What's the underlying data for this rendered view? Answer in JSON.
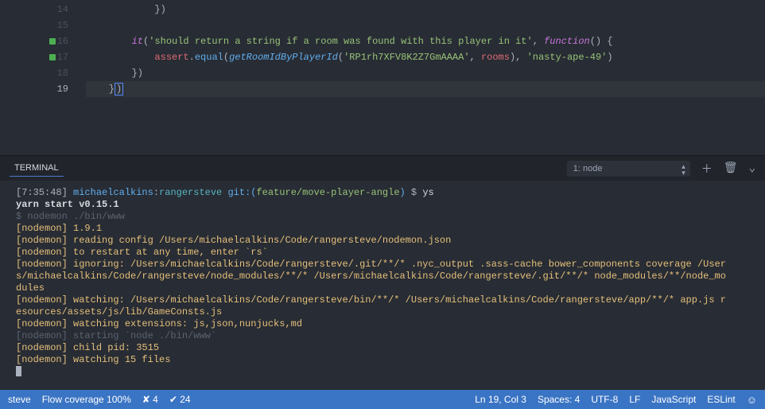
{
  "editor": {
    "lines": [
      14,
      15,
      16,
      17,
      18,
      19
    ],
    "code14_a": "            })",
    "code16_it": "        it",
    "code16_str": "'should return a string if a room was found with this player in it'",
    "code16_func": "function",
    "code16_rest": "() {",
    "code17_indent": "            ",
    "code17_assert": "assert",
    "code17_equal": "equal",
    "code17_fn": "getRoomIdByPlayerId",
    "code17_arg1": "'RP1rh7XFV8K2Z7GmAAAA'",
    "code17_rooms": "rooms",
    "code17_arg2": "'nasty-ape-49'",
    "code18_a": "        })",
    "code19_a": "    }",
    "code19_b": ")"
  },
  "panel": {
    "tab": "TERMINAL",
    "select": "1: node"
  },
  "term": {
    "time": "[7:35:48]",
    "user": "michaelcalkins",
    "host": "rangersteve",
    "gitpre": "git:(",
    "branch": "feature/move-player-angle",
    "gitpost": ")",
    "prompt": "$",
    "cmd": "ys",
    "l1": "yarn start v0.15.1",
    "l2": "$ nodemon ./bin/www",
    "l3a": "[nodemon]",
    "l3b": " 1.9.1",
    "l4a": "[nodemon]",
    "l4b": " reading config /Users/michaelcalkins/Code/rangersteve/nodemon.json",
    "l5a": "[nodemon]",
    "l5b": " to restart at any time, enter `rs`",
    "l6a": "[nodemon]",
    "l6b": " ignoring: /Users/michaelcalkins/Code/rangersteve/.git/**/* .nyc_output .sass-cache bower_components coverage /Users/michaelcalkins/Code/rangersteve/node_modules/**/* /Users/michaelcalkins/Code/rangersteve/.git/**/* node_modules/**/node_modules",
    "l7a": "[nodemon]",
    "l7b": " watching: /Users/michaelcalkins/Code/rangersteve/bin/**/* /Users/michaelcalkins/Code/rangersteve/app/**/* app.js resources/assets/js/lib/GameConsts.js",
    "l8a": "[nodemon]",
    "l8b": " watching extensions: js,json,nunjucks,md",
    "l9a": "[nodemon]",
    "l9b": " starting `node ./bin/www`",
    "l10a": "[nodemon]",
    "l10b": " child pid: 3515",
    "l11a": "[nodemon]",
    "l11b": " watching 15 files"
  },
  "status": {
    "steve": "steve",
    "flow": "Flow coverage 100%",
    "err": "✘ 4",
    "ok": "✔ 24",
    "pos": "Ln 19, Col 3",
    "spaces": "Spaces: 4",
    "enc": "UTF-8",
    "eol": "LF",
    "lang": "JavaScript",
    "lint": "ESLint"
  }
}
